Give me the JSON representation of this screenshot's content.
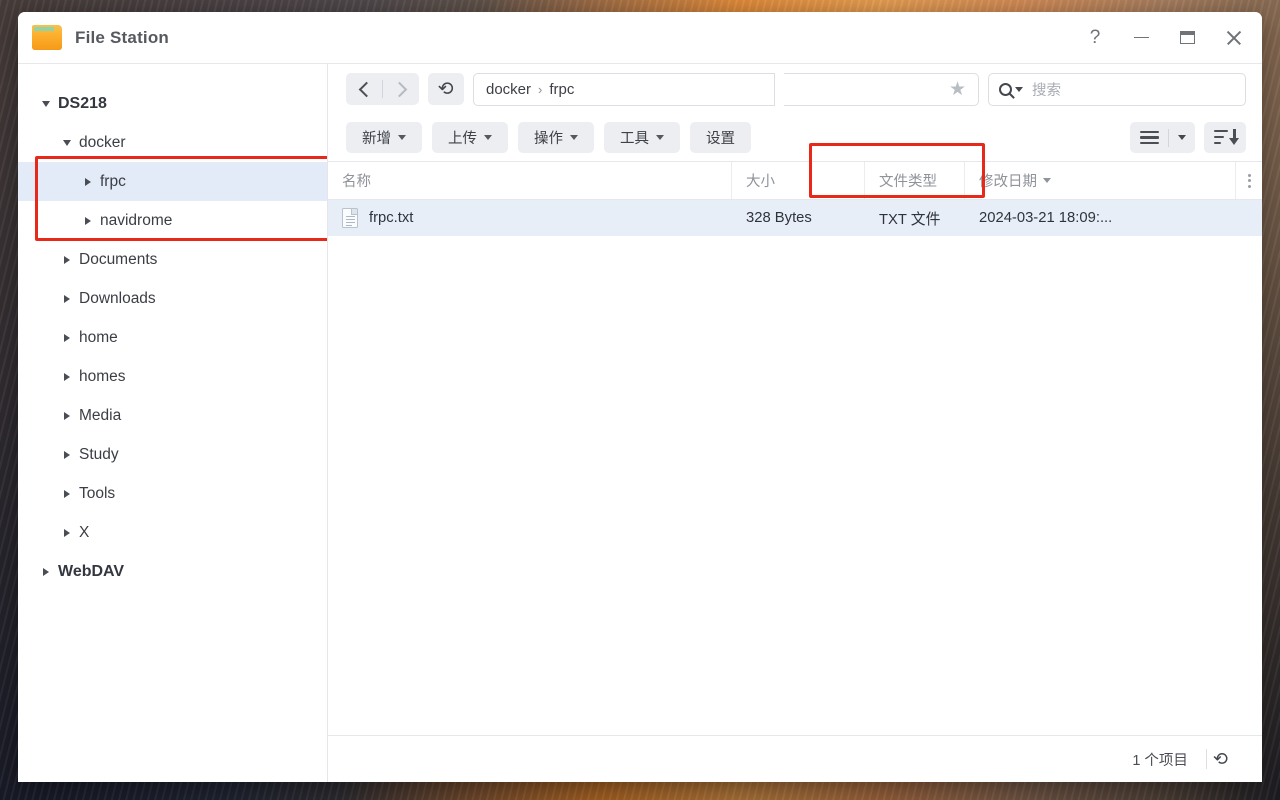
{
  "window": {
    "title": "File Station",
    "app_icon": "folder-icon",
    "controls": [
      {
        "name": "help",
        "glyph": "?"
      },
      {
        "name": "minimize",
        "glyph": "–"
      },
      {
        "name": "maximize",
        "glyph": "▢"
      },
      {
        "name": "close",
        "glyph": "✕"
      }
    ]
  },
  "sidebar": {
    "items": [
      {
        "label": "DS218",
        "level": 0,
        "caret": "down",
        "bold": true,
        "selected": false
      },
      {
        "label": "docker",
        "level": 1,
        "caret": "down",
        "bold": false,
        "selected": false
      },
      {
        "label": "frpc",
        "level": 2,
        "caret": "right",
        "bold": false,
        "selected": true
      },
      {
        "label": "navidrome",
        "level": 2,
        "caret": "right",
        "bold": false,
        "selected": false
      },
      {
        "label": "Documents",
        "level": 1,
        "caret": "right",
        "bold": false,
        "selected": false
      },
      {
        "label": "Downloads",
        "level": 1,
        "caret": "right",
        "bold": false,
        "selected": false
      },
      {
        "label": "home",
        "level": 1,
        "caret": "right",
        "bold": false,
        "selected": false
      },
      {
        "label": "homes",
        "level": 1,
        "caret": "right",
        "bold": false,
        "selected": false
      },
      {
        "label": "Media",
        "level": 1,
        "caret": "right",
        "bold": false,
        "selected": false
      },
      {
        "label": "Study",
        "level": 1,
        "caret": "right",
        "bold": false,
        "selected": false
      },
      {
        "label": "Tools",
        "level": 1,
        "caret": "right",
        "bold": false,
        "selected": false
      },
      {
        "label": "X",
        "level": 1,
        "caret": "right",
        "bold": false,
        "selected": false
      },
      {
        "label": "WebDAV",
        "level": 0,
        "caret": "right",
        "bold": true,
        "selected": false
      }
    ]
  },
  "navbar": {
    "back_icon": "chevron-left-icon",
    "forward_icon": "chevron-right-icon",
    "refresh_icon": "refresh-icon",
    "breadcrumb": [
      "docker",
      "frpc"
    ],
    "breadcrumb_separator": "›",
    "favorite_icon": "star-icon",
    "search": {
      "placeholder": "搜索",
      "value": "",
      "icon": "search-icon"
    }
  },
  "toolbar": {
    "buttons": [
      {
        "label": "新增",
        "dropdown": true
      },
      {
        "label": "上传",
        "dropdown": true
      },
      {
        "label": "操作",
        "dropdown": true
      },
      {
        "label": "工具",
        "dropdown": true
      },
      {
        "label": "设置",
        "dropdown": false
      }
    ],
    "view_icon": "list-view-icon",
    "view_dropdown_icon": "chevron-down-icon",
    "sort_icon": "sort-descending-icon"
  },
  "table": {
    "columns": [
      {
        "key": "name",
        "label": "名称",
        "sorted": false
      },
      {
        "key": "size",
        "label": "大小",
        "sorted": false
      },
      {
        "key": "type",
        "label": "文件类型",
        "sorted": false
      },
      {
        "key": "date",
        "label": "修改日期",
        "sorted": true
      }
    ],
    "options_icon": "column-options-icon",
    "rows": [
      {
        "icon": "text-file-icon",
        "name": "frpc.txt",
        "size": "328 Bytes",
        "type": "TXT 文件",
        "date": "2024-03-21 18:09:...",
        "selected": true
      }
    ]
  },
  "statusbar": {
    "item_count": "1 个项目",
    "refresh_icon": "refresh-icon"
  },
  "annotations": {
    "accent_color": "#e8291a",
    "boxes": [
      {
        "name": "sidebar-docker-frpc-highlight"
      },
      {
        "name": "breadcrumb-path-highlight"
      }
    ]
  }
}
